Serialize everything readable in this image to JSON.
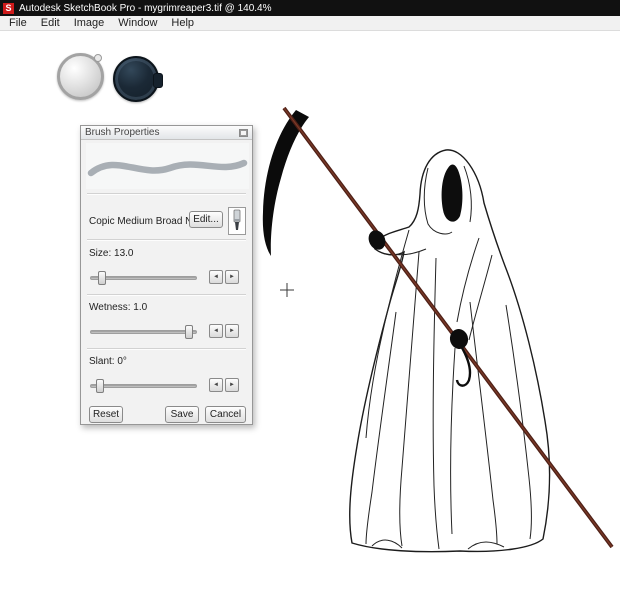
{
  "window": {
    "title": "Autodesk SketchBook Pro - mygrimreaper3.tif @ 140.4%",
    "logo_letter": "S"
  },
  "menu": {
    "items": [
      "File",
      "Edit",
      "Image",
      "Window",
      "Help"
    ]
  },
  "panel": {
    "title": "Brush Properties",
    "brush_name": "Copic Medium Broad Nib",
    "edit_label": "Edit...",
    "sliders": [
      {
        "label": "Size: 13.0",
        "value": 13.0,
        "pct": 10
      },
      {
        "label": "Wetness: 1.0",
        "value": 1.0,
        "pct": 93
      },
      {
        "label": "Slant: 0°",
        "value": 0,
        "pct": 9
      }
    ],
    "reset_label": "Reset",
    "save_label": "Save",
    "cancel_label": "Cancel"
  },
  "icons": {
    "left_arrow": "◄",
    "right_arrow": "►"
  },
  "colors": {
    "titlebar": "#111111",
    "logo_red": "#cf1b1b",
    "scythe_handle": "#4e2017",
    "blade": "#0b0b0b"
  }
}
